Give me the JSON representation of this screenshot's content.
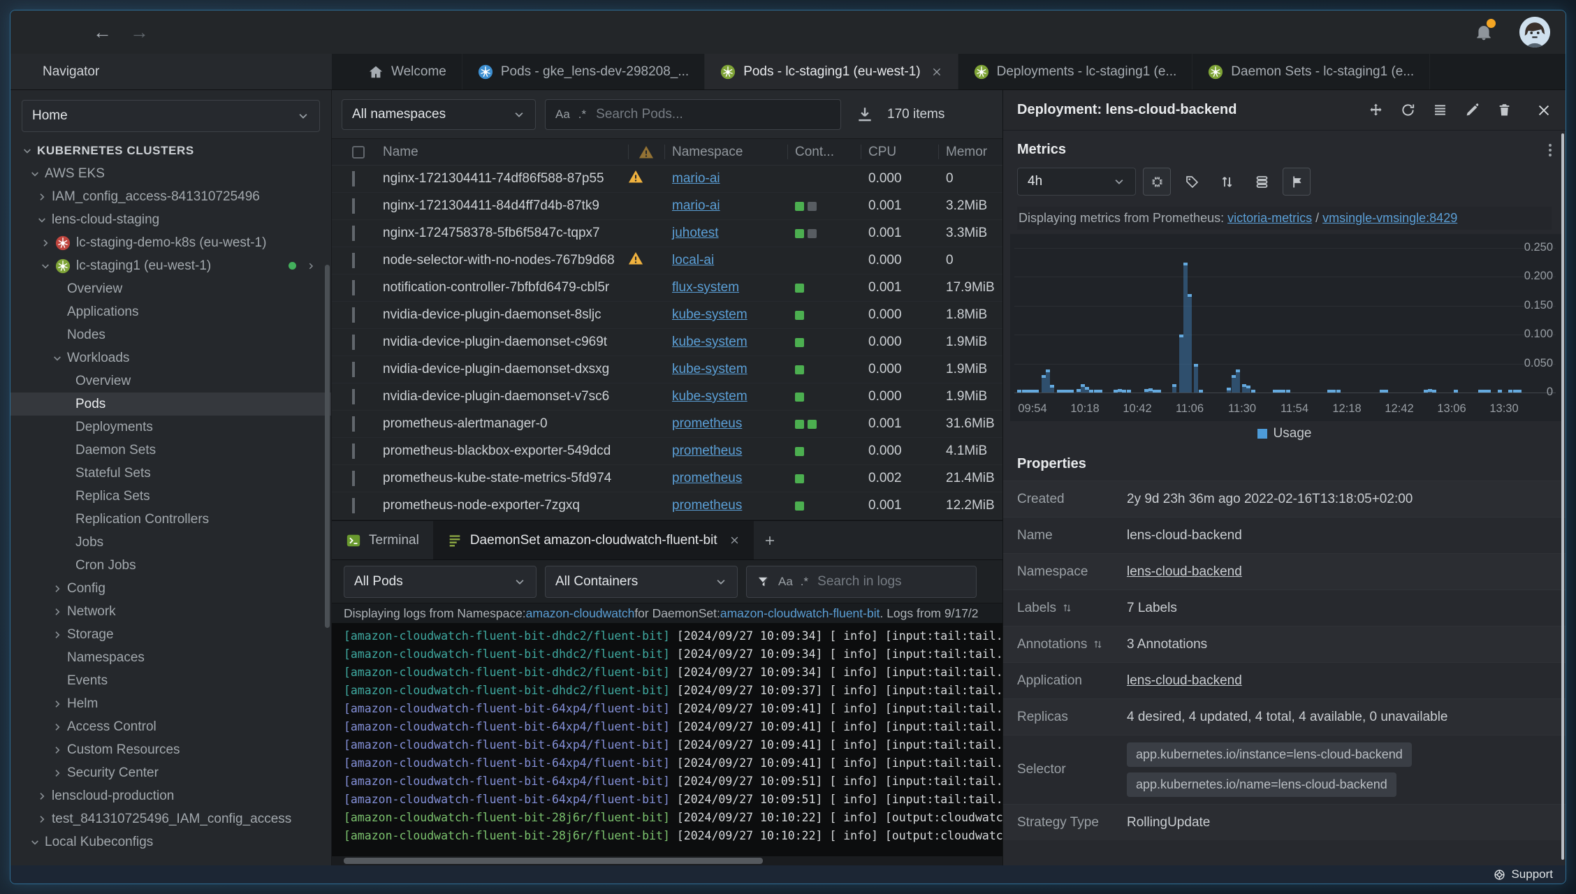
{
  "colors": {
    "link": "#5b9fd6",
    "warning": "#f0b23e",
    "container_running": "#4caf50",
    "container_idle": "#585d62",
    "chart_bar": "#3e7cb1",
    "chart_marker": "#64a9de",
    "status_dot": "#43b05c",
    "window_border": "#2e6d94"
  },
  "tabs": {
    "navigator": "Navigator",
    "items": [
      {
        "label": "Welcome",
        "icon": "home-icon",
        "active": false,
        "closable": false
      },
      {
        "label": "Pods - gke_lens-dev-298208_...",
        "icon": "kubernetes-blue-icon",
        "active": false,
        "closable": false
      },
      {
        "label": "Pods - lc-staging1 (eu-west-1)",
        "icon": "kubernetes-green-icon",
        "active": true,
        "closable": true
      },
      {
        "label": "Deployments - lc-staging1 (e...",
        "icon": "kubernetes-green-icon",
        "active": false,
        "closable": false
      },
      {
        "label": "Daemon Sets - lc-staging1 (e...",
        "icon": "kubernetes-green-icon",
        "active": false,
        "closable": false
      }
    ]
  },
  "sidebar": {
    "scope": "Home",
    "tree": [
      {
        "label": "KUBERNETES CLUSTERS",
        "level": 0,
        "chevron": "down",
        "header": true
      },
      {
        "label": "AWS EKS",
        "level": 1,
        "chevron": "down"
      },
      {
        "label": "IAM_config_access-841310725496",
        "level": 2,
        "chevron": "right"
      },
      {
        "label": "lens-cloud-staging",
        "level": 2,
        "chevron": "down"
      },
      {
        "label": "lc-staging-demo-k8s (eu-west-1)",
        "level": 3,
        "chevron": "right",
        "icon": "k8s-red"
      },
      {
        "label": "lc-staging1 (eu-west-1)",
        "level": 3,
        "chevron": "down",
        "icon": "k8s-green",
        "status_dot": true,
        "trailing_chevron": true
      },
      {
        "label": "Overview",
        "level": 4
      },
      {
        "label": "Applications",
        "level": 4
      },
      {
        "label": "Nodes",
        "level": 4
      },
      {
        "label": "Workloads",
        "level": 4,
        "chevron": "down"
      },
      {
        "label": "Overview",
        "level": 5
      },
      {
        "label": "Pods",
        "level": 5,
        "selected": true
      },
      {
        "label": "Deployments",
        "level": 5
      },
      {
        "label": "Daemon Sets",
        "level": 5
      },
      {
        "label": "Stateful Sets",
        "level": 5
      },
      {
        "label": "Replica Sets",
        "level": 5
      },
      {
        "label": "Replication Controllers",
        "level": 5
      },
      {
        "label": "Jobs",
        "level": 5
      },
      {
        "label": "Cron Jobs",
        "level": 5
      },
      {
        "label": "Config",
        "level": 4,
        "chevron": "right"
      },
      {
        "label": "Network",
        "level": 4,
        "chevron": "right"
      },
      {
        "label": "Storage",
        "level": 4,
        "chevron": "right"
      },
      {
        "label": "Namespaces",
        "level": 4
      },
      {
        "label": "Events",
        "level": 4
      },
      {
        "label": "Helm",
        "level": 4,
        "chevron": "right"
      },
      {
        "label": "Access Control",
        "level": 4,
        "chevron": "right"
      },
      {
        "label": "Custom Resources",
        "level": 4,
        "chevron": "right"
      },
      {
        "label": "Security Center",
        "level": 4,
        "chevron": "right"
      },
      {
        "label": "lenscloud-production",
        "level": 2,
        "chevron": "right"
      },
      {
        "label": "test_841310725496_IAM_config_access",
        "level": 2,
        "chevron": "right"
      },
      {
        "label": "Local Kubeconfigs",
        "level": 1,
        "chevron": "down"
      }
    ]
  },
  "pods": {
    "namespace_filter": "All namespaces",
    "search_placeholder": "Search Pods...",
    "case_glyph": "Aa",
    "regex_glyph": ".*",
    "items_count": "170 items",
    "header": {
      "name": "Name",
      "namespace": "Namespace",
      "containers": "Cont...",
      "cpu": "CPU",
      "memory": "Memor"
    },
    "rows": [
      {
        "name": "nginx-1721304411-74df86f588-87p55",
        "warning": true,
        "namespace": "mario-ai",
        "containers": [],
        "cpu": "0.000",
        "memory": "0"
      },
      {
        "name": "nginx-1721304411-84d4ff7d4b-87tk9",
        "warning": false,
        "namespace": "mario-ai",
        "containers": [
          "running",
          "idle"
        ],
        "cpu": "0.001",
        "memory": "3.2MiB"
      },
      {
        "name": "nginx-1724758378-5fb6f5847c-tqpx7",
        "warning": false,
        "namespace": "juhotest",
        "containers": [
          "running",
          "idle"
        ],
        "cpu": "0.001",
        "memory": "3.3MiB"
      },
      {
        "name": "node-selector-with-no-nodes-767b9d68",
        "warning": true,
        "namespace": "local-ai",
        "containers": [],
        "cpu": "0.000",
        "memory": "0"
      },
      {
        "name": "notification-controller-7bfbfd6479-cbl5r",
        "warning": false,
        "namespace": "flux-system",
        "containers": [
          "running"
        ],
        "cpu": "0.001",
        "memory": "17.9MiB"
      },
      {
        "name": "nvidia-device-plugin-daemonset-8sljc",
        "warning": false,
        "namespace": "kube-system",
        "containers": [
          "running"
        ],
        "cpu": "0.000",
        "memory": "1.8MiB"
      },
      {
        "name": "nvidia-device-plugin-daemonset-c969t",
        "warning": false,
        "namespace": "kube-system",
        "containers": [
          "running"
        ],
        "cpu": "0.000",
        "memory": "1.9MiB"
      },
      {
        "name": "nvidia-device-plugin-daemonset-dxsxg",
        "warning": false,
        "namespace": "kube-system",
        "containers": [
          "running"
        ],
        "cpu": "0.000",
        "memory": "1.9MiB"
      },
      {
        "name": "nvidia-device-plugin-daemonset-v7sc6",
        "warning": false,
        "namespace": "kube-system",
        "containers": [
          "running"
        ],
        "cpu": "0.000",
        "memory": "1.9MiB"
      },
      {
        "name": "prometheus-alertmanager-0",
        "warning": false,
        "namespace": "prometheus",
        "containers": [
          "running",
          "running"
        ],
        "cpu": "0.001",
        "memory": "31.6MiB"
      },
      {
        "name": "prometheus-blackbox-exporter-549dcd",
        "warning": false,
        "namespace": "prometheus",
        "containers": [
          "running"
        ],
        "cpu": "0.000",
        "memory": "4.1MiB"
      },
      {
        "name": "prometheus-kube-state-metrics-5fd974",
        "warning": false,
        "namespace": "prometheus",
        "containers": [
          "running"
        ],
        "cpu": "0.002",
        "memory": "21.4MiB"
      },
      {
        "name": "prometheus-node-exporter-7zgxq",
        "warning": false,
        "namespace": "prometheus",
        "containers": [
          "running"
        ],
        "cpu": "0.001",
        "memory": "12.2MiB"
      }
    ]
  },
  "dock": {
    "terminal_tab": "Terminal",
    "logs_tab": "DaemonSet amazon-cloudwatch-fluent-bit",
    "pods_filter": "All Pods",
    "containers_filter": "All Containers",
    "search_placeholder": "Search in logs",
    "case_glyph": "Aa",
    "regex_glyph": ".*",
    "info": {
      "prefix": "Displaying logs from Namespace: ",
      "namespace_link": "amazon-cloudwatch",
      "middle": " for DaemonSet: ",
      "daemonset_link": "amazon-cloudwatch-fluent-bit",
      "suffix": ". Logs from 9/17/2"
    },
    "log_lines": [
      {
        "pod": "[amazon-cloudwatch-fluent-bit-dhdc2/fluent-bit]",
        "color": "teal",
        "rest": " [2024/09/27 10:09:34] [ info] [input:tail:tail.0] in"
      },
      {
        "pod": "[amazon-cloudwatch-fluent-bit-dhdc2/fluent-bit]",
        "color": "teal",
        "rest": " [2024/09/27 10:09:34] [ info] [input:tail:tail.0] in"
      },
      {
        "pod": "[amazon-cloudwatch-fluent-bit-dhdc2/fluent-bit]",
        "color": "teal",
        "rest": " [2024/09/27 10:09:34] [ info] [input:tail:tail.0] in"
      },
      {
        "pod": "[amazon-cloudwatch-fluent-bit-dhdc2/fluent-bit]",
        "color": "teal",
        "rest": " [2024/09/27 10:09:37] [ info] [input:tail:tail.0] in"
      },
      {
        "pod": "[amazon-cloudwatch-fluent-bit-64xp4/fluent-bit]",
        "color": "indigo",
        "rest": " [2024/09/27 10:09:41] [ info] [input:tail:tail.0] in"
      },
      {
        "pod": "[amazon-cloudwatch-fluent-bit-64xp4/fluent-bit]",
        "color": "indigo",
        "rest": " [2024/09/27 10:09:41] [ info] [input:tail:tail.0] in"
      },
      {
        "pod": "[amazon-cloudwatch-fluent-bit-64xp4/fluent-bit]",
        "color": "indigo",
        "rest": " [2024/09/27 10:09:41] [ info] [input:tail:tail.0] in"
      },
      {
        "pod": "[amazon-cloudwatch-fluent-bit-64xp4/fluent-bit]",
        "color": "indigo",
        "rest": " [2024/09/27 10:09:41] [ info] [input:tail:tail.0] in"
      },
      {
        "pod": "[amazon-cloudwatch-fluent-bit-64xp4/fluent-bit]",
        "color": "indigo",
        "rest": " [2024/09/27 10:09:51] [ info] [input:tail:tail.0] in"
      },
      {
        "pod": "[amazon-cloudwatch-fluent-bit-64xp4/fluent-bit]",
        "color": "indigo",
        "rest": " [2024/09/27 10:09:51] [ info] [input:tail:tail.0] in"
      },
      {
        "pod": "[amazon-cloudwatch-fluent-bit-28j6r/fluent-bit]",
        "color": "green",
        "rest": " [2024/09/27 10:10:22] [ info] [output:cloudwatch_log"
      },
      {
        "pod": "[amazon-cloudwatch-fluent-bit-28j6r/fluent-bit]",
        "color": "green",
        "rest": " [2024/09/27 10:10:22] [ info] [output:cloudwatch_log"
      }
    ]
  },
  "details": {
    "title": "Deployment: lens-cloud-backend",
    "toolbar_icons": [
      "move-icon",
      "refresh-icon",
      "menu-icon",
      "edit-icon",
      "trash-icon",
      "close-icon"
    ],
    "metrics": {
      "section_title": "Metrics",
      "timeframe": "4h",
      "toolbar_icons": [
        "cpu-chip-icon",
        "tag-icon",
        "sort-arrows-icon",
        "stack-icon",
        "flag-icon"
      ],
      "source_prefix": "Displaying metrics from Prometheus: ",
      "source_link1": "victoria-metrics",
      "source_sep": " / ",
      "source_link2": "vmsingle-vmsingle:8429"
    },
    "properties": {
      "title": "Properties",
      "rows": [
        {
          "label": "Created",
          "type": "text",
          "value": "2y 9d 23h 36m ago 2022-02-16T13:18:05+02:00"
        },
        {
          "label": "Name",
          "type": "text",
          "value": "lens-cloud-backend"
        },
        {
          "label": "Namespace",
          "type": "link",
          "value": "lens-cloud-backend"
        },
        {
          "label": "Labels",
          "type": "text",
          "sortable": true,
          "value": "7 Labels"
        },
        {
          "label": "Annotations",
          "type": "text",
          "sortable": true,
          "value": "3 Annotations"
        },
        {
          "label": "Application",
          "type": "link",
          "value": "lens-cloud-backend"
        },
        {
          "label": "Replicas",
          "type": "text",
          "value": "4 desired, 4 updated, 4 total, 4 available, 0 unavailable"
        },
        {
          "label": "Selector",
          "type": "badges",
          "badges": [
            "app.kubernetes.io/instance=lens-cloud-backend",
            "app.kubernetes.io/name=lens-cloud-backend"
          ]
        },
        {
          "label": "Strategy Type",
          "type": "text",
          "value": "RollingUpdate"
        }
      ]
    }
  },
  "statusbar": {
    "support": "Support"
  },
  "chart_data": {
    "type": "bar",
    "title": "Deployment lens-cloud-backend CPU usage",
    "legend": [
      "Usage"
    ],
    "legend_position": "bottom-center",
    "grid": true,
    "x_ticks": [
      "09:54",
      "10:18",
      "10:42",
      "11:06",
      "11:30",
      "11:54",
      "12:18",
      "12:42",
      "13:06",
      "13:30"
    ],
    "y_ticks": [
      "0.250",
      "0.200",
      "0.150",
      "0.100",
      "0.050",
      "0"
    ],
    "y_tick_values": [
      0.25,
      0.2,
      0.15,
      0.1,
      0.05,
      0
    ],
    "ylim": [
      0,
      0.27
    ],
    "x_minutes_per_tick": 24,
    "points_t_minutes_from_first_tick_v_cores": [
      [
        -6,
        0.002
      ],
      [
        -4,
        0.002
      ],
      [
        -2,
        0.003
      ],
      [
        0,
        0.002
      ],
      [
        2,
        0.003
      ],
      [
        5,
        0.03
      ],
      [
        7,
        0.04
      ],
      [
        9,
        0.013
      ],
      [
        12,
        0.004
      ],
      [
        14,
        0.003
      ],
      [
        16,
        0.004
      ],
      [
        18,
        0.003
      ],
      [
        21,
        0.006
      ],
      [
        23,
        0.015
      ],
      [
        25,
        0.01
      ],
      [
        27,
        0.004
      ],
      [
        29,
        0.003
      ],
      [
        31,
        0.002
      ],
      [
        38,
        0.005
      ],
      [
        40,
        0.006
      ],
      [
        42,
        0.004
      ],
      [
        44,
        0.003
      ],
      [
        52,
        0.006
      ],
      [
        54,
        0.007
      ],
      [
        56,
        0.004
      ],
      [
        58,
        0.002
      ],
      [
        65,
        0.015
      ],
      [
        68,
        0.1
      ],
      [
        70,
        0.225
      ],
      [
        72,
        0.17
      ],
      [
        75,
        0.05
      ],
      [
        77,
        0.004
      ],
      [
        90,
        0.008
      ],
      [
        92,
        0.03
      ],
      [
        94,
        0.04
      ],
      [
        97,
        0.015
      ],
      [
        99,
        0.012
      ],
      [
        101,
        0.004
      ],
      [
        111,
        0.002
      ],
      [
        113,
        0.002
      ],
      [
        115,
        0.003
      ],
      [
        117,
        0.002
      ],
      [
        136,
        0.003
      ],
      [
        138,
        0.003
      ],
      [
        140,
        0.002
      ],
      [
        160,
        0.003
      ],
      [
        162,
        0.003
      ],
      [
        180,
        0.005
      ],
      [
        182,
        0.006
      ],
      [
        184,
        0.004
      ],
      [
        194,
        0.002
      ],
      [
        205,
        0.002
      ],
      [
        207,
        0.003
      ],
      [
        209,
        0.002
      ],
      [
        214,
        0.002
      ],
      [
        219,
        0.002
      ],
      [
        221,
        0.004
      ],
      [
        223,
        0.003
      ]
    ]
  }
}
